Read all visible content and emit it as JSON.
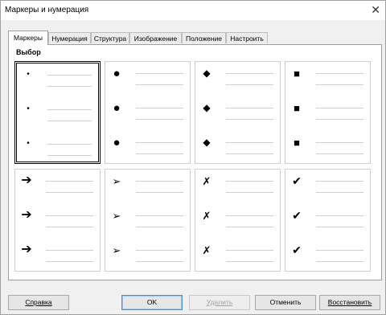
{
  "window": {
    "title": "Маркеры и нумерация",
    "close_glyph": "✕"
  },
  "tabs": [
    {
      "label": "Маркеры",
      "active": true
    },
    {
      "label": "Нумерация",
      "active": false
    },
    {
      "label": "Структура",
      "active": false
    },
    {
      "label": "Изображение",
      "active": false
    },
    {
      "label": "Положение",
      "active": false
    },
    {
      "label": "Настроить",
      "active": false
    }
  ],
  "section": {
    "label": "Выбор"
  },
  "styles": [
    {
      "name": "small-dot",
      "glyph": "•",
      "selected": true
    },
    {
      "name": "large-dot",
      "glyph": "●",
      "selected": false
    },
    {
      "name": "diamond",
      "glyph": "◆",
      "selected": false
    },
    {
      "name": "square",
      "glyph": "■",
      "selected": false
    },
    {
      "name": "arrow",
      "glyph": "➔",
      "selected": false
    },
    {
      "name": "arrowhead",
      "glyph": "➢",
      "selected": false
    },
    {
      "name": "cross",
      "glyph": "✗",
      "selected": false
    },
    {
      "name": "check",
      "glyph": "✔",
      "selected": false
    }
  ],
  "buttons": {
    "help": "Справка",
    "ok": "OK",
    "delete": "Удалить",
    "cancel": "Отменить",
    "restore": "Восстановить"
  }
}
